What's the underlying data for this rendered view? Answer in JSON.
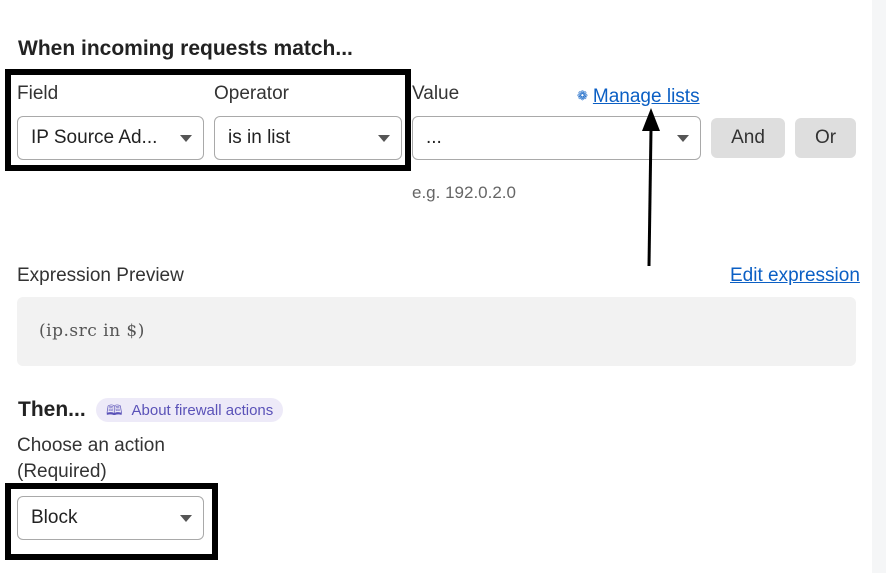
{
  "rule": {
    "heading": "When incoming requests match...",
    "field_label": "Field",
    "operator_label": "Operator",
    "value_label": "Value",
    "manage_lists_icon": "gear-icon",
    "manage_lists_label": "Manage lists",
    "field_value": "IP Source Ad...",
    "operator_value": "is in list",
    "value_value": "...",
    "and_label": "And",
    "or_label": "Or",
    "value_hint": "e.g. 192.0.2.0"
  },
  "expression": {
    "label": "Expression Preview",
    "edit_label": "Edit expression",
    "code": "(ip.src in $)"
  },
  "then": {
    "heading": "Then...",
    "about_icon": "book-icon",
    "about_label": "About firewall actions",
    "choose_label": "Choose an action",
    "required_label": "(Required)",
    "action_value": "Block"
  },
  "colors": {
    "link": "#0b5fc4",
    "pill_bg": "#edeaf8",
    "pill_text": "#5a52b8",
    "highlight": "#000000"
  }
}
